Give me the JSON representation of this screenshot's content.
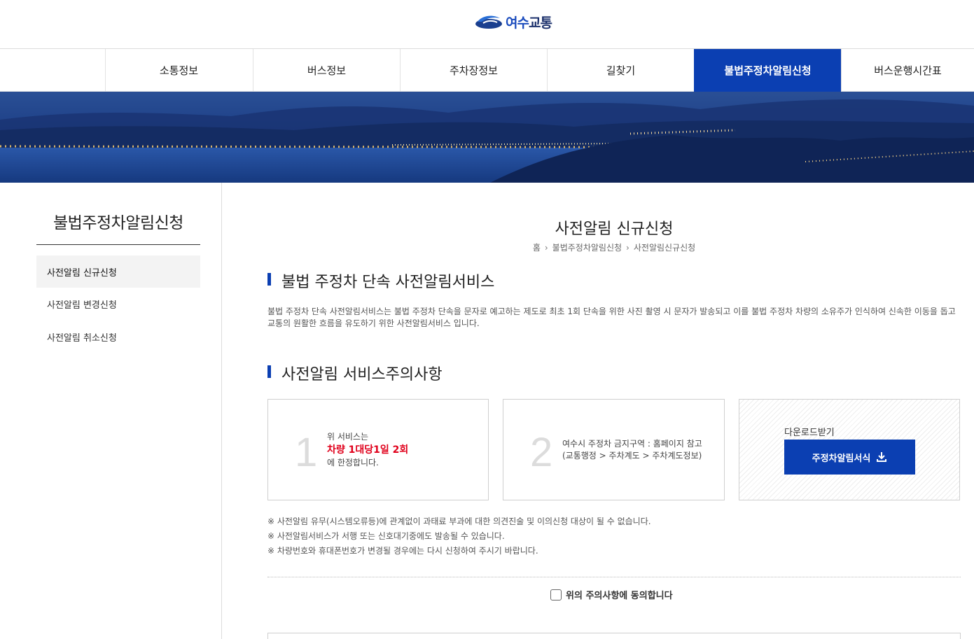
{
  "header": {
    "logo_text_a": "여수",
    "logo_text_b": "교통"
  },
  "nav": {
    "items": [
      {
        "label": "소통정보"
      },
      {
        "label": "버스정보"
      },
      {
        "label": "주차장정보"
      },
      {
        "label": "길찾기"
      },
      {
        "label": "불법주정차알림신청"
      },
      {
        "label": "버스운행시간표"
      }
    ],
    "active_index": 4
  },
  "sidebar": {
    "title": "불법주정차알림신청",
    "items": [
      {
        "label": "사전알림 신규신청"
      },
      {
        "label": "사전알림 변경신청"
      },
      {
        "label": "사전알림 취소신청"
      }
    ]
  },
  "main": {
    "title": "사전알림 신규신청",
    "breadcrumb": {
      "home": "홈",
      "level1": "불법주정차알림신청",
      "level2": "사전알림신규신청"
    },
    "section1": {
      "title": "불법 주정차 단속 사전알림서비스",
      "description": "불법 주정차 단속 사전알림서비스는 불법 주정차 단속을 문자로 예고하는 제도로 최초 1회 단속을 위한 사진 촬영 시 문자가 발송되고 이를 불법 주정차 차량의 소유주가 인식하여 신속한 이동을 돕고 교통의 원활한 흐름을 유도하기 위한 사전알림서비스 입니다."
    },
    "section2": {
      "title": "사전알림 서비스주의사항",
      "card1": {
        "number": "1",
        "line1": "위 서비스는",
        "highlight": "차량 1대당1일 2회",
        "line3": "에 한정합니다."
      },
      "card2": {
        "number": "2",
        "line1": "여수시 주정차 금지구역 : 홈페이지 참고",
        "line2": "(교통행정 > 주차계도 > 주차계도정보)"
      },
      "card3": {
        "label": "다운로드받기",
        "button": "주정차알림서식"
      },
      "notes": [
        "※ 사전알림 유무(시스템오류등)에 관계없이 과태료 부과에 대한 의견진술 및 이의신청 대상이 될 수 없습니다.",
        "※ 사전알림서비스가 서행 또는 신호대기중에도 발송될 수 있습니다.",
        "※ 차량번호와 휴대폰번호가 변경될 경우에는 다시 신청하여 주시기 바랍니다."
      ],
      "agree_label": "위의 주의사항에 동의합니다",
      "agree_checked": false
    }
  },
  "colors": {
    "accent": "#0b3fb2",
    "highlight": "#e0001b"
  },
  "icons": {
    "download": "download-icon",
    "breadcrumb_sep": "chevron-right-icon"
  }
}
